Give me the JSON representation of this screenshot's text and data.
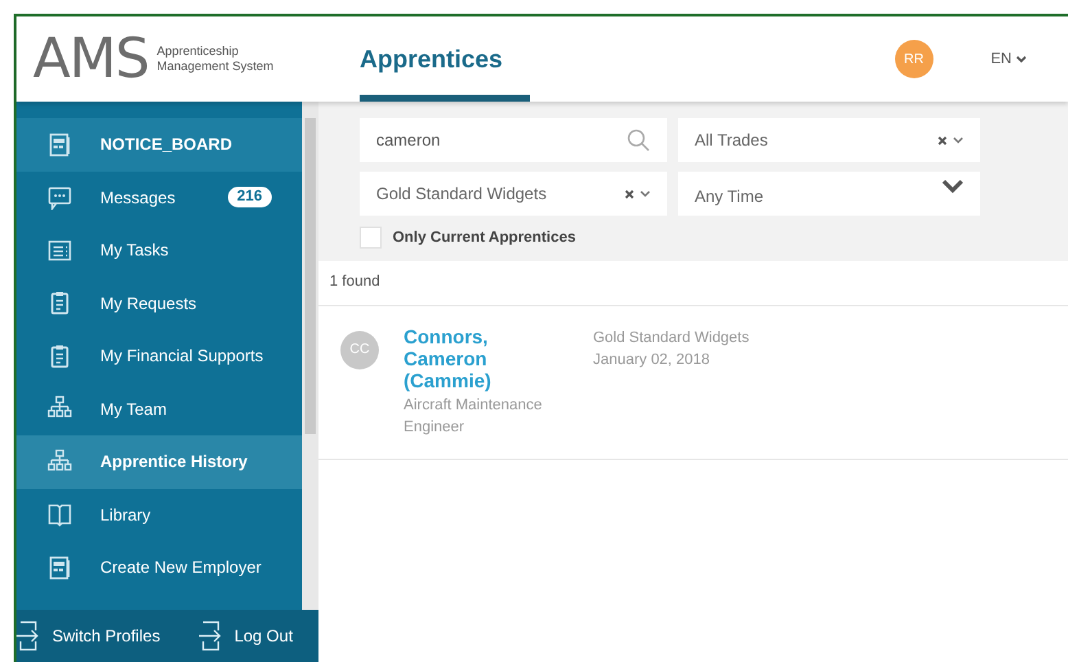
{
  "header": {
    "logo": "AMS",
    "logo_subtitle": [
      "Apprenticeship",
      "Management System"
    ],
    "page_title": "Apprentices",
    "user_initials": "RR",
    "language": "EN"
  },
  "sidebar": {
    "items": [
      {
        "label": "NOTICE_BOARD",
        "kind": "board",
        "selected": false,
        "bold": true
      },
      {
        "label": "Messages",
        "kind": "chat",
        "selected": false,
        "bold": false,
        "badge": "216"
      },
      {
        "label": "My Tasks",
        "kind": "list",
        "selected": false,
        "bold": false
      },
      {
        "label": "My Requests",
        "kind": "clipboard",
        "selected": false,
        "bold": false
      },
      {
        "label": "My Financial Supports",
        "kind": "clipboard",
        "selected": false,
        "bold": false
      },
      {
        "label": "My Team",
        "kind": "tree",
        "selected": false,
        "bold": false
      },
      {
        "label": "Apprentice History",
        "kind": "tree",
        "selected": true,
        "bold": true
      },
      {
        "label": "Library",
        "kind": "book",
        "selected": false,
        "bold": false
      },
      {
        "label": "Create New Employer",
        "kind": "board",
        "selected": false,
        "bold": false
      }
    ],
    "footer": [
      "Switch Profiles",
      "Log Out"
    ]
  },
  "filters": {
    "search": "cameron",
    "trade": "All Trades",
    "employer": "Gold Standard Widgets",
    "time": "Any Time",
    "only_current": {
      "label": "Only Current Apprentices",
      "checked": false
    }
  },
  "results": {
    "count": "1 found",
    "rows": [
      {
        "initials": "CC",
        "name": "Connors, Cameron (Cammie)",
        "trade": "Aircraft Maintenance Engineer",
        "employer": "Gold Standard Widgets",
        "date": "January 02, 2018"
      }
    ]
  }
}
